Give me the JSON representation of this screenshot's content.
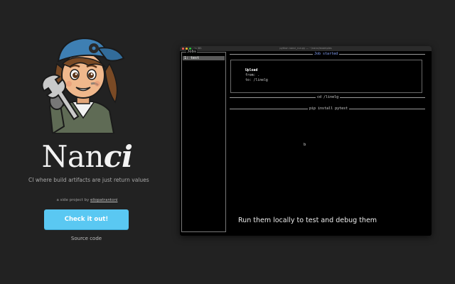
{
  "brand": {
    "name_prefix": "Nan",
    "name_suffix": "ci",
    "tagline": "CI where build artifacts are just return values",
    "side_project_prefix": "a side project by",
    "author": "eliopatrantoni"
  },
  "cta": {
    "label": "Check it out!"
  },
  "source_link": {
    "label": "Source code"
  },
  "colors": {
    "background": "#222222",
    "cta_button": "#5ac8f2",
    "job_started": "#8aa7ff"
  },
  "terminal": {
    "window_title": "python nanci_run.py — ~/nanci/examples",
    "tab_label": "⌥ ⌘1",
    "jobs_panel": {
      "title": "Jobs",
      "items": [
        "1: test"
      ]
    },
    "sections": {
      "job_started": "Job started",
      "cd_step": "cd /linelg",
      "pip_step": "pip install pytest"
    },
    "upload": {
      "title": "Upload",
      "from_line": "from: .",
      "to_line": "to: /linelg"
    },
    "cursor_char": "b",
    "caption": "Run them locally to test and debug them"
  },
  "icons": {
    "mascot": "mechanic-girl-with-wrench-illustration",
    "window_close": "window-close-icon",
    "window_minimize": "window-minimize-icon",
    "window_zoom": "window-zoom-icon"
  }
}
